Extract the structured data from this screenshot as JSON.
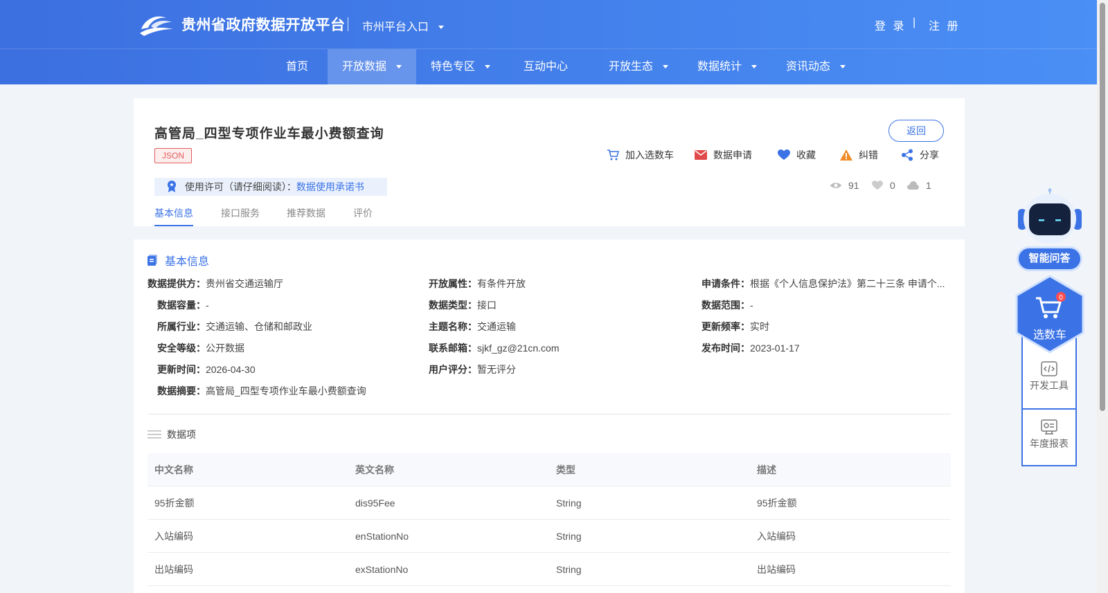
{
  "header": {
    "site_title": "贵州省政府数据开放平台",
    "city_entry": "市州平台入口",
    "login": "登 录",
    "separator": "|",
    "register": "注 册"
  },
  "nav": {
    "items": [
      {
        "label": "首页",
        "dropdown": false,
        "active": false
      },
      {
        "label": "开放数据",
        "dropdown": true,
        "active": true
      },
      {
        "label": "特色专区",
        "dropdown": true,
        "active": false
      },
      {
        "label": "互动中心",
        "dropdown": false,
        "active": false
      },
      {
        "label": "开放生态",
        "dropdown": true,
        "active": false
      },
      {
        "label": "数据统计",
        "dropdown": true,
        "active": false
      },
      {
        "label": "资讯动态",
        "dropdown": true,
        "active": false
      }
    ]
  },
  "dataset": {
    "title": "高管局_四型专项作业车最小费额查询",
    "format": "JSON",
    "back": "返回",
    "actions": {
      "cart": "加入选数车",
      "apply": "数据申请",
      "favorite": "收藏",
      "report": "纠错",
      "share": "分享"
    },
    "license_label": "使用许可（请仔细阅读）：",
    "license_link": "数据使用承诺书",
    "stats": {
      "views": "91",
      "likes": "0",
      "downloads": "1"
    },
    "tabs": [
      "基本信息",
      "接口服务",
      "推荐数据",
      "评价"
    ]
  },
  "basic_info": {
    "title": "基本信息",
    "fields": {
      "provider": {
        "k": "数据提供方：",
        "v": "贵州省交通运输厅"
      },
      "open_attr": {
        "k": "开放属性：",
        "v": "有条件开放"
      },
      "apply_cond": {
        "k": "申请条件：",
        "v": "根据《个人信息保护法》第二十三条 申请个..."
      },
      "capacity": {
        "k": "数据容量：",
        "v": "-"
      },
      "data_type": {
        "k": "数据类型：",
        "v": "接口"
      },
      "range": {
        "k": "数据范围：",
        "v": "-"
      },
      "industry": {
        "k": "所属行业：",
        "v": "交通运输、仓储和邮政业"
      },
      "topic": {
        "k": "主题名称：",
        "v": "交通运输"
      },
      "frequency": {
        "k": "更新频率：",
        "v": "实时"
      },
      "security": {
        "k": "安全等级：",
        "v": "公开数据"
      },
      "email": {
        "k": "联系邮箱：",
        "v": "sjkf_gz@21cn.com"
      },
      "publish": {
        "k": "发布时间：",
        "v": "2023-01-17"
      },
      "updated": {
        "k": "更新时间：",
        "v": "2026-04-30"
      },
      "rating": {
        "k": "用户评分：",
        "v": "暂无评分"
      },
      "summary": {
        "k": "数据摘要：",
        "v": "高管局_四型专项作业车最小费额查询"
      }
    }
  },
  "data_items": {
    "title": "数据项",
    "headers": [
      "中文名称",
      "英文名称",
      "类型",
      "描述"
    ],
    "rows": [
      [
        "95折金额",
        "dis95Fee",
        "String",
        "95折金额"
      ],
      [
        "入站编码",
        "enStationNo",
        "String",
        "入站编码"
      ],
      [
        "出站编码",
        "exStationNo",
        "String",
        "出站编码"
      ]
    ]
  },
  "sidebar": {
    "ai": "智能问答",
    "cart": "选数车",
    "cart_count": "0",
    "dev_tools": "开发工具",
    "annual": "年度报表"
  },
  "colors": {
    "primary": "#3b73e6",
    "tag_red": "#e15b5b",
    "header_start": "#3c6fe0",
    "header_end": "#4a8ff5"
  },
  "icons": [
    "logo-icon",
    "cart-icon",
    "mail-icon",
    "heart-icon",
    "warning-icon",
    "share-icon",
    "license-badge-icon",
    "eye-icon",
    "like-icon",
    "cloud-icon",
    "doc-icon",
    "list-icon",
    "robot-icon",
    "code-icon",
    "report-icon"
  ]
}
